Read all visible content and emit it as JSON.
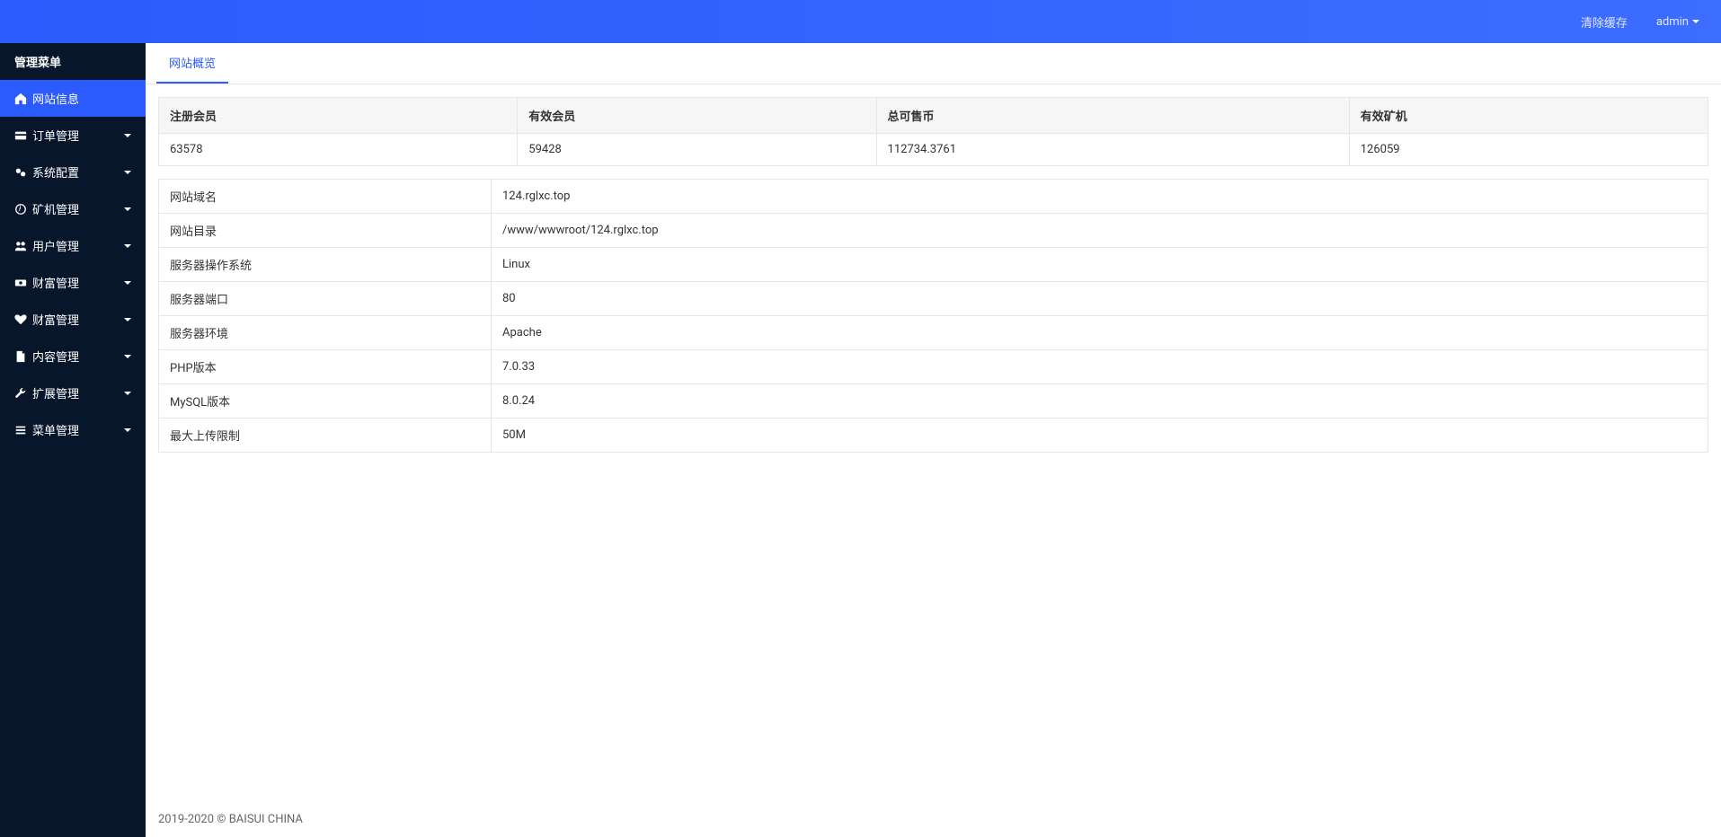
{
  "header": {
    "clear_cache": "清除缓存",
    "user": "admin"
  },
  "sidebar": {
    "title": "管理菜单",
    "items": [
      {
        "label": "网站信息",
        "icon": "home",
        "active": true,
        "has_children": false
      },
      {
        "label": "订单管理",
        "icon": "card",
        "active": false,
        "has_children": true
      },
      {
        "label": "系统配置",
        "icon": "gears",
        "active": false,
        "has_children": true
      },
      {
        "label": "矿机管理",
        "icon": "rebel",
        "active": false,
        "has_children": true
      },
      {
        "label": "用户管理",
        "icon": "users",
        "active": false,
        "has_children": true
      },
      {
        "label": "财富管理",
        "icon": "money",
        "active": false,
        "has_children": true
      },
      {
        "label": "财富管理",
        "icon": "heartbeat",
        "active": false,
        "has_children": true
      },
      {
        "label": "内容管理",
        "icon": "file",
        "active": false,
        "has_children": true
      },
      {
        "label": "扩展管理",
        "icon": "wrench",
        "active": false,
        "has_children": true
      },
      {
        "label": "菜单管理",
        "icon": "bars",
        "active": false,
        "has_children": true
      }
    ]
  },
  "tabs": {
    "overview": "网站概览"
  },
  "stats": {
    "headers": [
      "注册会员",
      "有效会员",
      "总可售币",
      "有效矿机"
    ],
    "values": [
      "63578",
      "59428",
      "112734.3761",
      "126059"
    ]
  },
  "info": [
    {
      "label": "网站域名",
      "value": "124.rglxc.top"
    },
    {
      "label": "网站目录",
      "value": "/www/wwwroot/124.rglxc.top"
    },
    {
      "label": "服务器操作系统",
      "value": "Linux"
    },
    {
      "label": "服务器端口",
      "value": "80"
    },
    {
      "label": "服务器环境",
      "value": "Apache"
    },
    {
      "label": "PHP版本",
      "value": "7.0.33"
    },
    {
      "label": "MySQL版本",
      "value": "8.0.24"
    },
    {
      "label": "最大上传限制",
      "value": "50M"
    }
  ],
  "footer": "2019-2020 © BAISUI CHINA"
}
